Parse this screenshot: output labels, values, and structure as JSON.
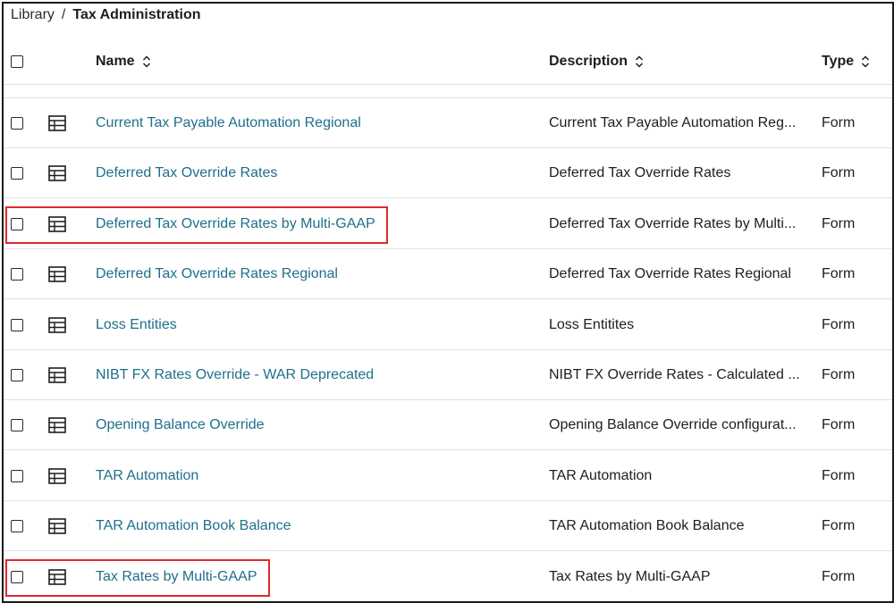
{
  "breadcrumb": {
    "library": "Library",
    "separator": "/",
    "current": "Tax Administration"
  },
  "table": {
    "columns": {
      "name": "Name",
      "description": "Description",
      "type": "Type"
    },
    "rows": [
      {
        "name": "Current Tax Payable Automation Regional",
        "description": "Current Tax Payable Automation Reg...",
        "type": "Form",
        "highlighted": false
      },
      {
        "name": "Deferred Tax Override Rates",
        "description": "Deferred Tax Override Rates",
        "type": "Form",
        "highlighted": false
      },
      {
        "name": "Deferred Tax Override Rates by Multi-GAAP",
        "description": "Deferred Tax Override Rates by Multi...",
        "type": "Form",
        "highlighted": true
      },
      {
        "name": "Deferred Tax Override Rates Regional",
        "description": "Deferred Tax Override Rates Regional",
        "type": "Form",
        "highlighted": false
      },
      {
        "name": "Loss Entities",
        "description": "Loss Entitites",
        "type": "Form",
        "highlighted": false
      },
      {
        "name": "NIBT FX Rates Override - WAR Deprecated",
        "description": "NIBT FX Override Rates - Calculated ...",
        "type": "Form",
        "highlighted": false
      },
      {
        "name": "Opening Balance Override",
        "description": "Opening Balance Override configurat...",
        "type": "Form",
        "highlighted": false
      },
      {
        "name": "TAR Automation",
        "description": "TAR Automation",
        "type": "Form",
        "highlighted": false
      },
      {
        "name": "TAR Automation Book Balance",
        "description": "TAR Automation Book Balance",
        "type": "Form",
        "highlighted": false
      },
      {
        "name": "Tax Rates by Multi-GAAP",
        "description": "Tax Rates by Multi-GAAP",
        "type": "Form",
        "highlighted": true
      }
    ],
    "row_icon": "form-grid-icon",
    "sort_icon": "sort-up-down-icon"
  },
  "colors": {
    "link": "#1f6f8b",
    "highlight": "#e0292f",
    "divider": "#e2e2e2"
  }
}
